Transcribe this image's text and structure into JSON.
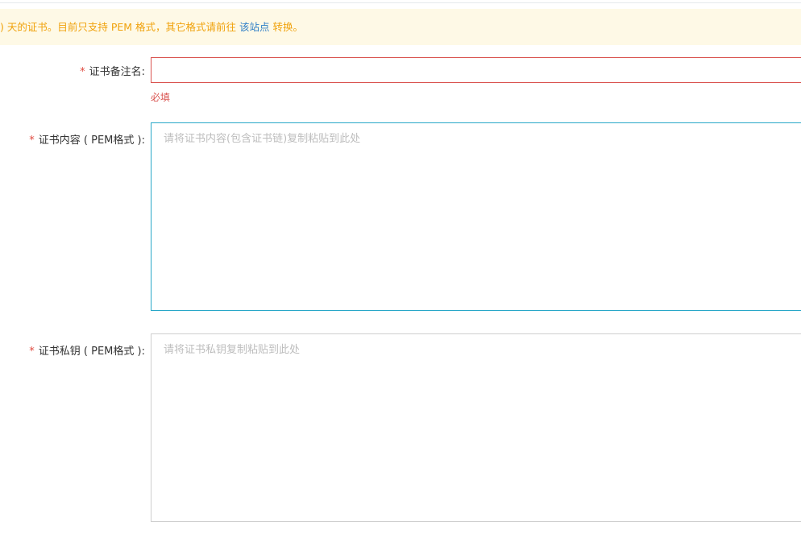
{
  "notice": {
    "text_before": ") 天的证书。目前只支持 PEM 格式，其它格式请前往 ",
    "link_text": "该站点",
    "text_after": " 转换。"
  },
  "form": {
    "required_mark": "*",
    "name": {
      "label": "证书备注名:",
      "value": "",
      "error": "必填"
    },
    "cert": {
      "label": "证书内容 ( PEM格式 ):",
      "placeholder": "请将证书内容(包含证书链)复制粘贴到此处",
      "value": ""
    },
    "key": {
      "label": "证书私钥 ( PEM格式 ):",
      "placeholder": "请将证书私钥复制粘贴到此处",
      "value": ""
    }
  },
  "colors": {
    "notice_bg": "#fef9e6",
    "notice_text": "#f0a20c",
    "link": "#2f7fc7",
    "required": "#e04a3f",
    "error": "#d9534f",
    "focus_border": "#28a7c8",
    "default_border": "#cfcfcf"
  }
}
